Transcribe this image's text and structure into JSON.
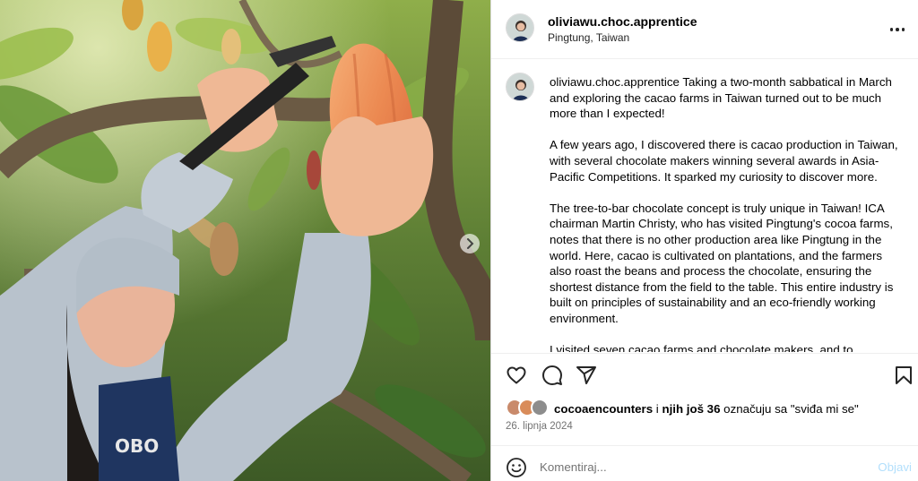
{
  "post": {
    "username": "oliviawu.choc.apprentice",
    "location": "Pingtung, Taiwan",
    "more_icon": "more-horizontal-icon"
  },
  "caption": {
    "username": "oliviawu.choc.apprentice",
    "paragraphs": [
      "Taking a two-month sabbatical in March and exploring the cacao farms in Taiwan turned out to be much more than I expected!",
      "A few years ago, I discovered there is cacao production in Taiwan, with several chocolate makers winning several awards in Asia-Pacific Competitions. It sparked my curiosity to discover more.",
      "The tree-to-bar chocolate concept is truly unique in Taiwan! ICA chairman Martin Christy, who has visited Pingtung's cocoa farms, notes that there is no other production area like Pingtung in the world. Here, cacao is cultivated on plantations, and the farmers also roast the beans and process the chocolate, ensuring the shortest distance from the field to the table. This entire industry is built on principles of sustainability and an eco-friendly working environment.",
      "I visited seven cacao farms and chocolate makers, and to"
    ]
  },
  "actions": {
    "like_icon": "heart-icon",
    "comment_icon": "comment-icon",
    "share_icon": "share-icon",
    "save_icon": "bookmark-icon"
  },
  "likes": {
    "user": "cocoaencounters",
    "connector": " i ",
    "others": "njih još 36",
    "suffix": " označuju sa \"sviđa mi se\""
  },
  "date": "26. lipnja 2024",
  "comment": {
    "placeholder": "Komentiraj...",
    "post_label": "Objavi",
    "emoji_icon": "emoji-icon"
  },
  "carousel": {
    "next_icon": "chevron-right-icon"
  }
}
